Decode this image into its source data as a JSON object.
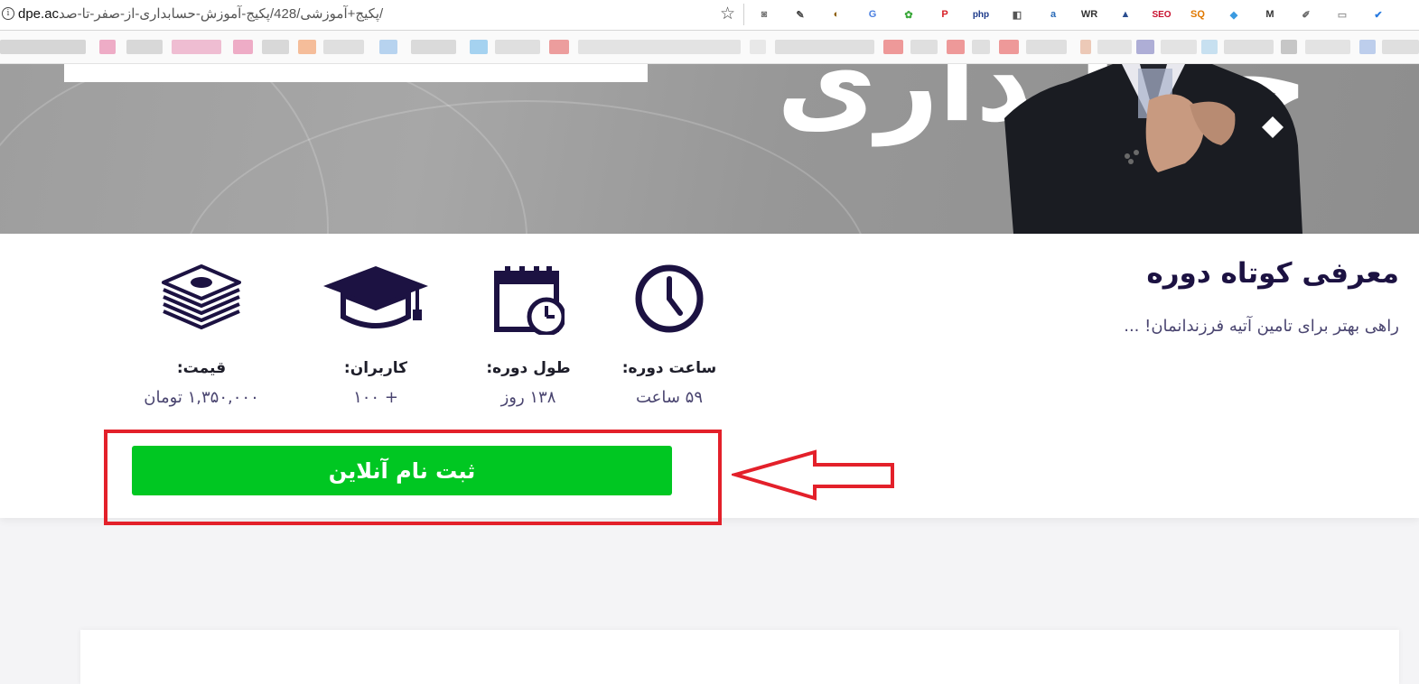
{
  "browser": {
    "url_domain": "dpe.ac",
    "url_path": "/پکیج+آموزشی/428/پکیج-آموزش-حسابداری-از-صفر-تا-صد",
    "extensions": [
      {
        "name": "camera-icon",
        "glyph": "◙",
        "color": "#777777"
      },
      {
        "name": "eyedropper-icon",
        "glyph": "✎",
        "color": "#444444"
      },
      {
        "name": "shield-extension-icon",
        "glyph": "◐",
        "color": "#8a5a00"
      },
      {
        "name": "translate-icon",
        "glyph": "G",
        "color": "#4a7fe0"
      },
      {
        "name": "frog-icon",
        "glyph": "✿",
        "color": "#3aa83a"
      },
      {
        "name": "pinterest-icon",
        "glyph": "P",
        "color": "#d81f26"
      },
      {
        "name": "php-icon",
        "text": "php",
        "color": "#1d3a8a"
      },
      {
        "name": "puzzle-icon",
        "glyph": "◧",
        "color": "#555555"
      },
      {
        "name": "alexa-icon",
        "glyph": "a",
        "color": "#2a6bb8"
      },
      {
        "name": "wr-icon",
        "text": "WR",
        "color": "#333333"
      },
      {
        "name": "analytics-icon",
        "glyph": "▲",
        "color": "#2a4d8f"
      },
      {
        "name": "seo-icon",
        "text": "SEO",
        "color": "#c8102e"
      },
      {
        "name": "seoquake-icon",
        "text": "SQ",
        "color": "#e07800"
      },
      {
        "name": "water-drop-icon",
        "glyph": "◆",
        "color": "#3a9ae0"
      },
      {
        "name": "m-icon",
        "text": "M",
        "color": "#333333"
      },
      {
        "name": "brush-icon",
        "glyph": "✐",
        "color": "#666666"
      },
      {
        "name": "note-icon",
        "glyph": "▭",
        "color": "#999999"
      },
      {
        "name": "check-icon",
        "glyph": "✔",
        "color": "#2a7be0"
      }
    ]
  },
  "hero": {
    "word": "حسابداری"
  },
  "course": {
    "intro_title": "معرفی کوتاه دوره",
    "intro_subtitle": "راهی بهتر برای تامین آتیه فرزندانمان! ...",
    "stats": [
      {
        "icon": "clock-icon",
        "label": "ساعت دوره:",
        "value": "۵۹ ساعت"
      },
      {
        "icon": "calendar-clock-icon",
        "label": "طول دوره:",
        "value": "۱۳۸ روز"
      },
      {
        "icon": "graduation-cap-icon",
        "label": "کاربران:",
        "value": "+ ۱۰۰"
      },
      {
        "icon": "money-stack-icon",
        "label": "قیمت:",
        "value": "۱,۳۵۰,۰۰۰ تومان"
      }
    ],
    "register_label": "ثبت نام آنلاین"
  },
  "colors": {
    "accent_dark": "#1c1242",
    "button_green": "#00c722",
    "annotation_red": "#e3202a"
  }
}
